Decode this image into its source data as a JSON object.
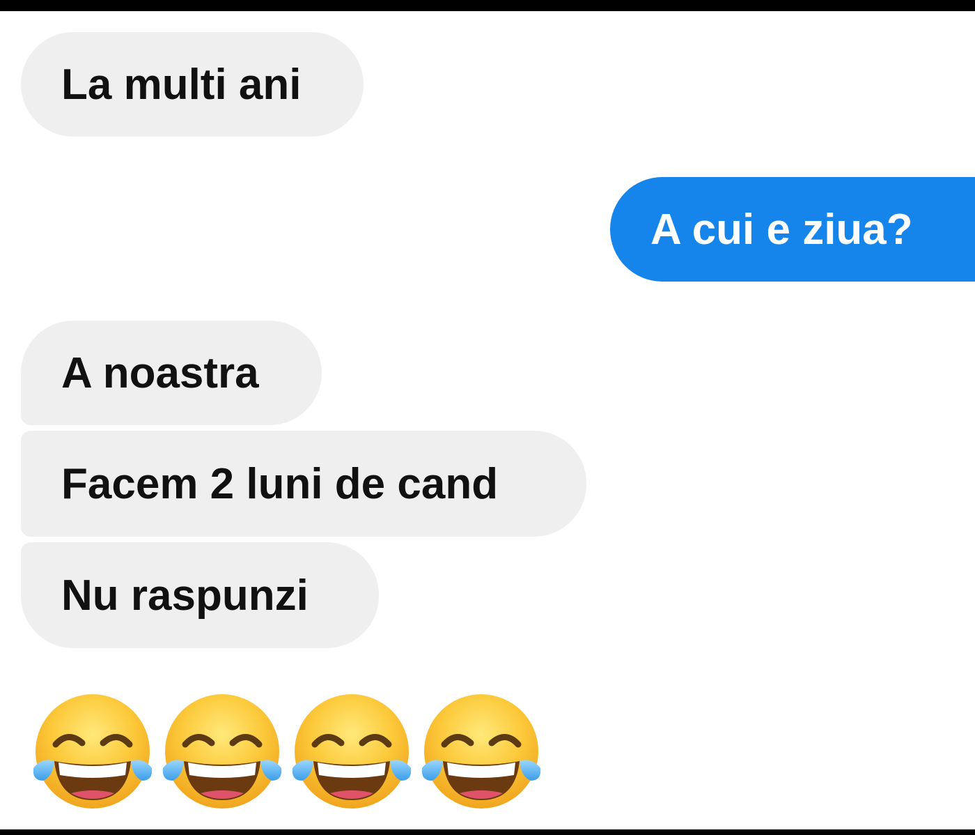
{
  "messages": [
    {
      "text": "La multi ani",
      "side": "received"
    },
    {
      "text": "A cui e ziua?",
      "side": "sent"
    },
    {
      "text": "A noastra",
      "side": "received"
    },
    {
      "text": "Facem 2 luni de cand",
      "side": "received"
    },
    {
      "text": "Nu raspunzi",
      "side": "received"
    }
  ],
  "reaction": {
    "icon": "face-with-tears-of-joy-icon",
    "count": 4
  },
  "colors": {
    "sent_bubble": "#1584eb",
    "received_bubble": "#efefef",
    "received_text": "#111111",
    "sent_text": "#ffffff"
  }
}
